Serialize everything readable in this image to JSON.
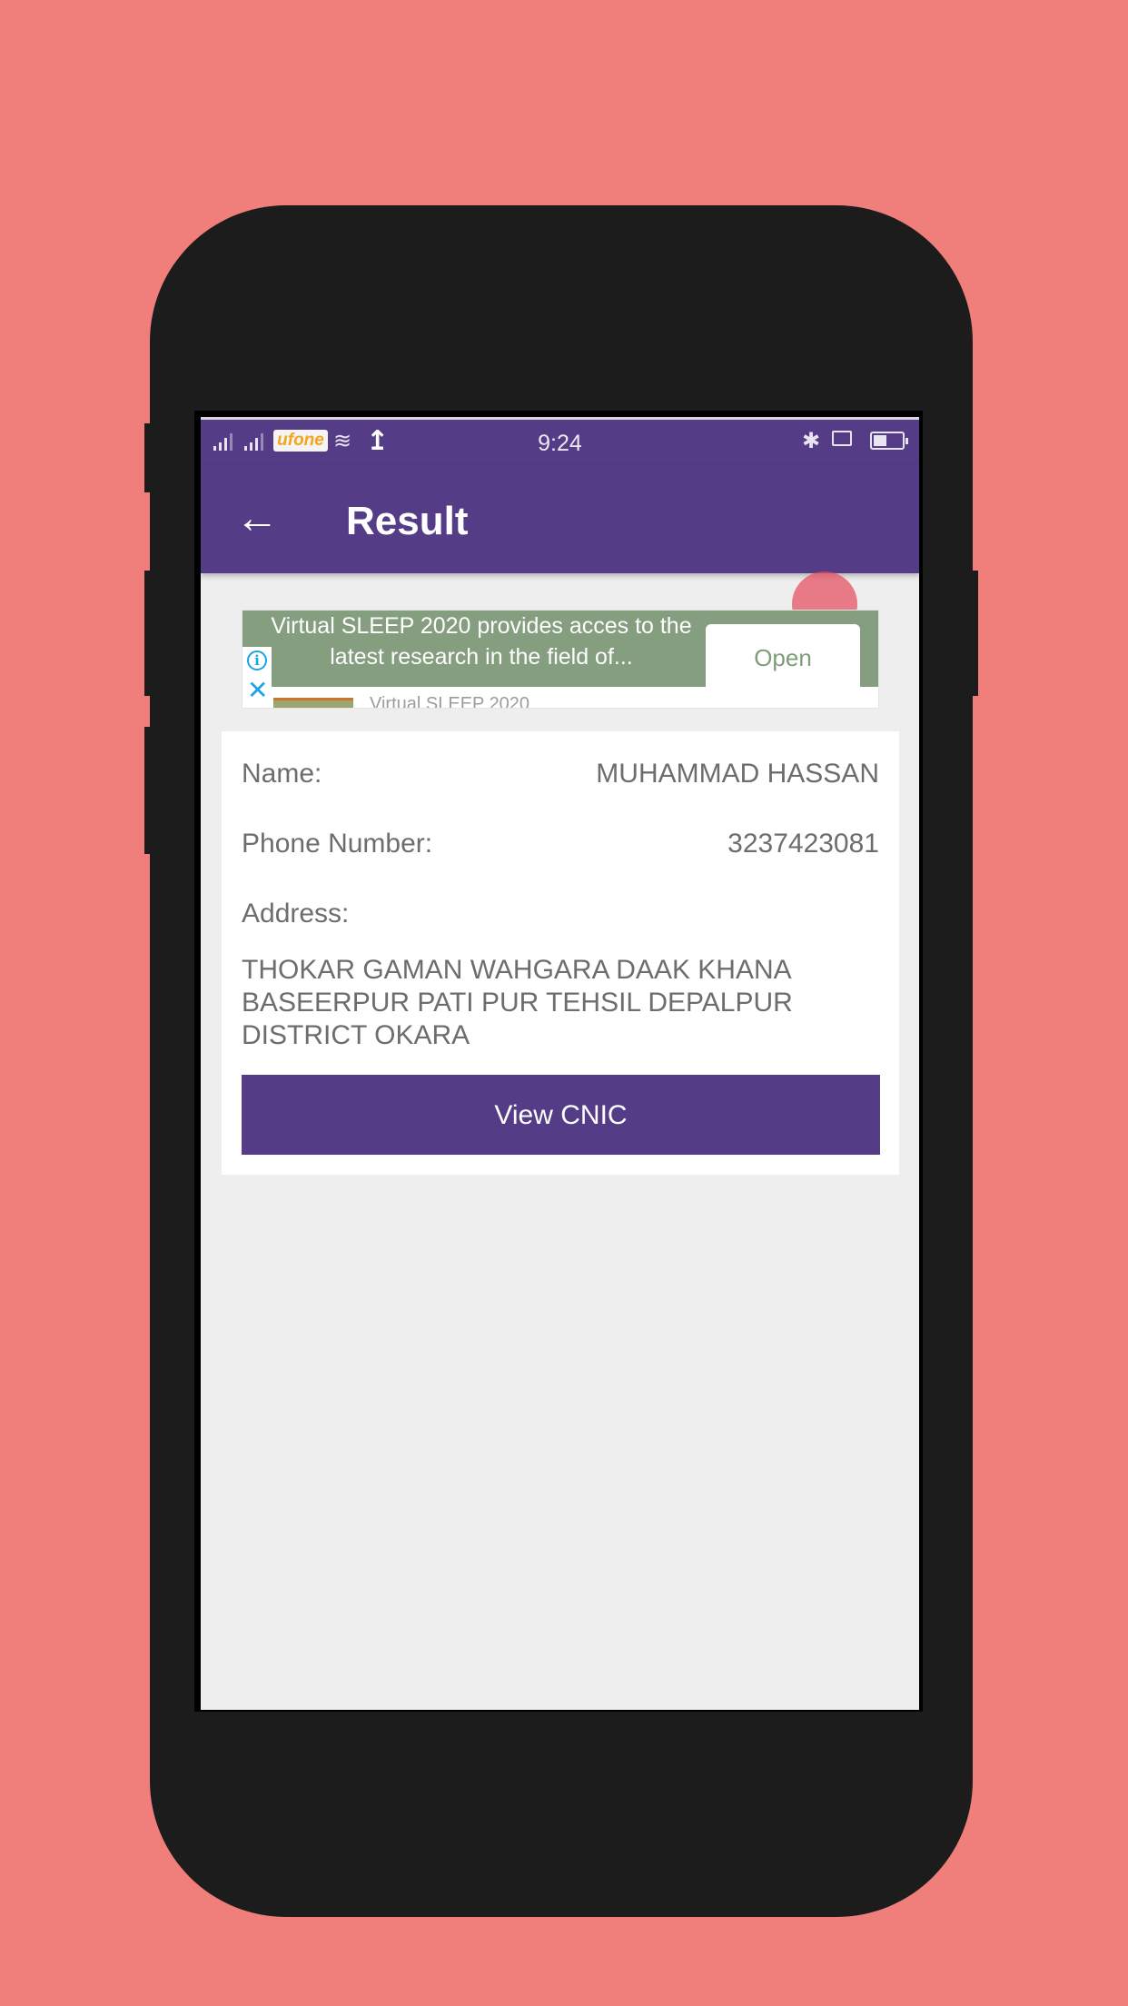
{
  "status_bar": {
    "carrier": "ufone",
    "time": "9:24",
    "battery_level": 0.45
  },
  "app_bar": {
    "title": "Result"
  },
  "ad": {
    "headline": "Virtual SLEEP 2020 provides acces to the latest research in the field of...",
    "cta": "Open",
    "subtitle": "Virtual SLEEP 2020"
  },
  "details": {
    "name_label": "Name:",
    "name_value": "MUHAMMAD HASSAN",
    "phone_label": "Phone Number:",
    "phone_value": "3237423081",
    "address_label": "Address:",
    "address_value": "THOKAR GAMAN WAHGARA DAAK KHANA BASEERPUR PATI PUR TEHSIL DEPALPUR DISTRICT OKARA",
    "button_label": "View CNIC"
  },
  "colors": {
    "primary": "#553c87",
    "background": "#f07f7c",
    "ad_green": "#859e7f",
    "ad_icon_blue": "#1aa3e5"
  }
}
